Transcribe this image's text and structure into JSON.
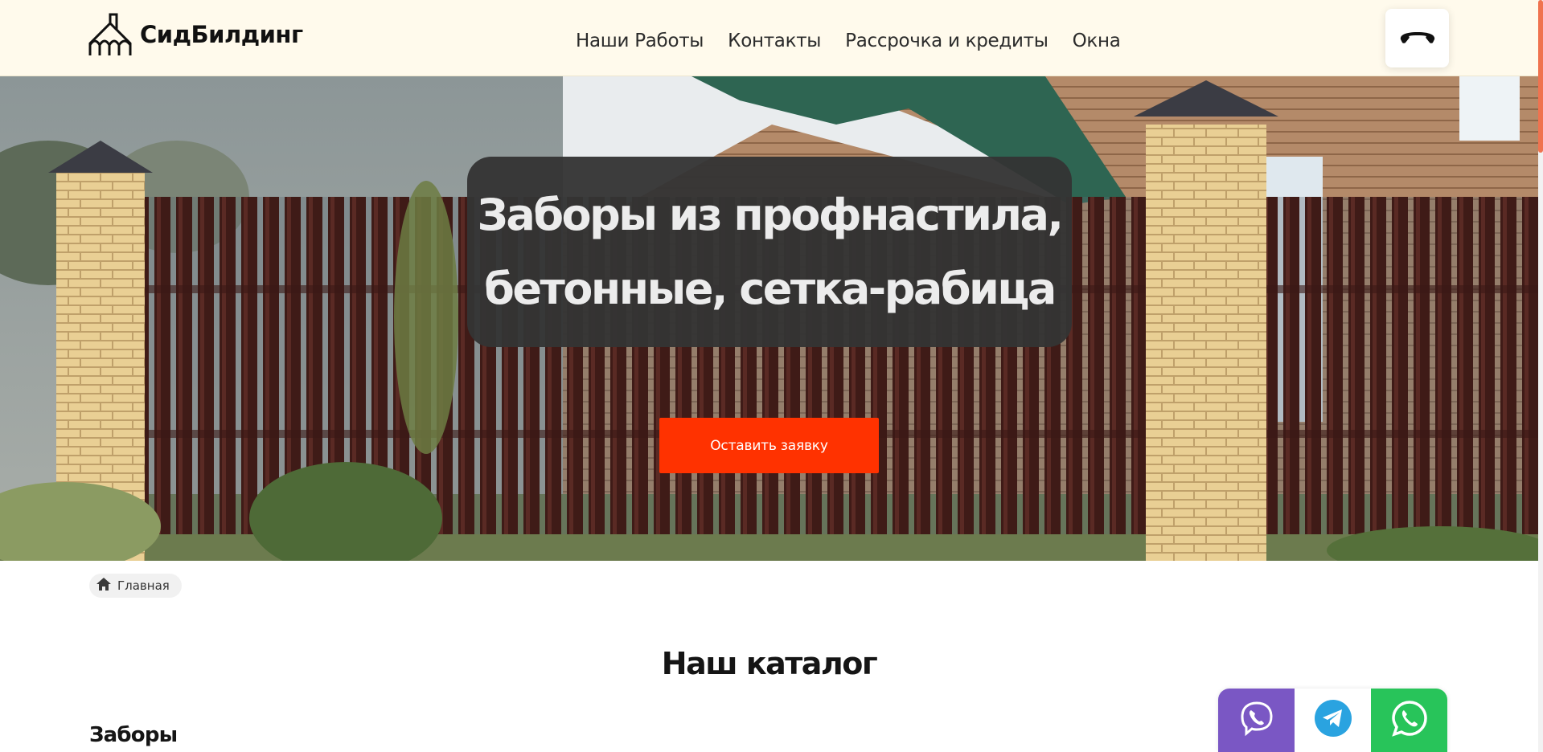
{
  "brand": {
    "name": "СидБилдинг",
    "logo_icon": "house-arches-icon"
  },
  "nav": {
    "items": [
      {
        "label": "Наши Работы"
      },
      {
        "label": "Контакты"
      },
      {
        "label": "Рассрочка и кредиты"
      },
      {
        "label": "Окна"
      }
    ]
  },
  "header": {
    "phone_icon": "phone-handset-icon"
  },
  "hero": {
    "title_line1": "Заборы из профнастила,",
    "title_line2": "бетонные, сетка-рабица",
    "cta_label": "Оставить заявку",
    "background": "fence-photo"
  },
  "breadcrumb": {
    "home_icon": "home-icon",
    "label": "Главная"
  },
  "catalog": {
    "title": "Наш каталог",
    "first_category": "Заборы"
  },
  "messengers": [
    {
      "name": "Viber",
      "icon": "viber-icon",
      "color": "#7a57c4"
    },
    {
      "name": "Telegram",
      "icon": "telegram-icon",
      "color": "#2aa3e0"
    },
    {
      "name": "WhatsApp",
      "icon": "whatsapp-icon",
      "color": "#28c45a"
    }
  ],
  "colors": {
    "header_bg": "#fffaec",
    "accent": "#ff3200",
    "hero_box": "#343434"
  }
}
